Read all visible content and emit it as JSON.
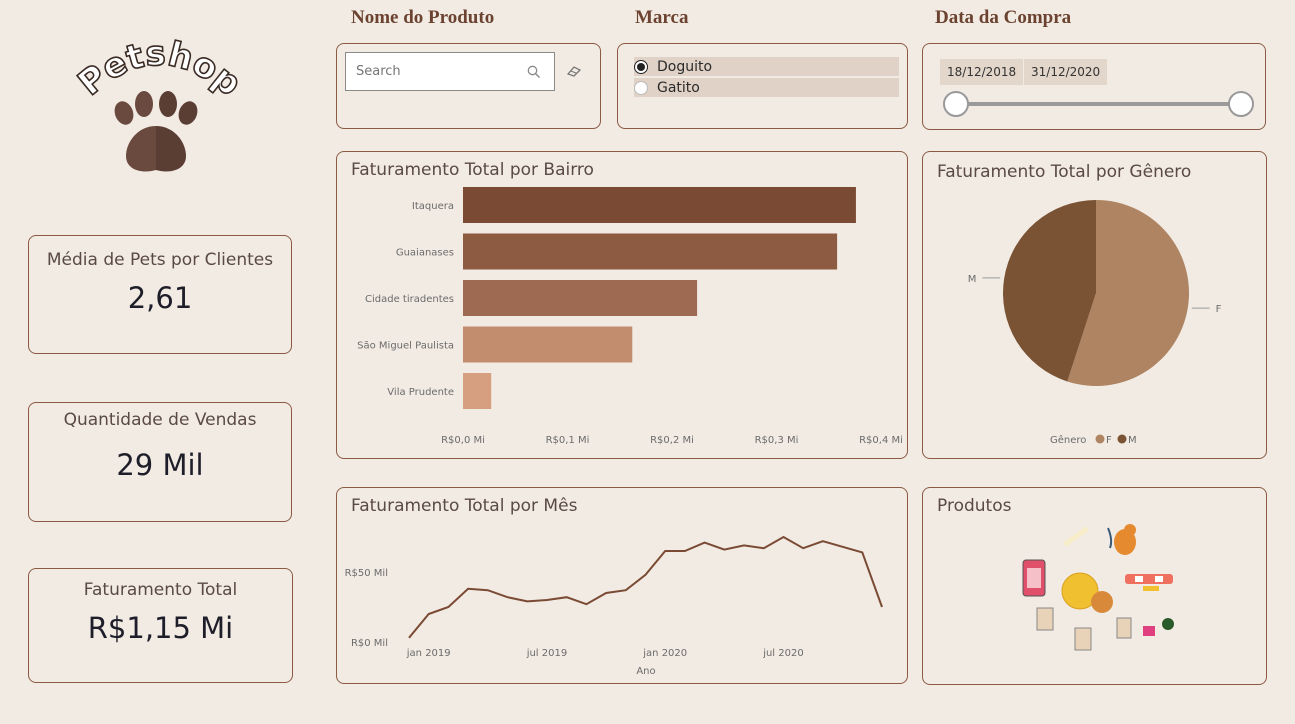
{
  "logo": {
    "text": "Petshop"
  },
  "filters": {
    "produto": {
      "title": "Nome do Produto",
      "placeholder": "Search"
    },
    "marca": {
      "title": "Marca",
      "options": [
        {
          "label": "Doguito",
          "selected": true
        },
        {
          "label": "Gatito",
          "selected": false
        }
      ]
    },
    "data": {
      "title": "Data da Compra",
      "start": "18/12/2018",
      "end": "31/12/2020"
    }
  },
  "kpis": {
    "media_pets": {
      "label": "Média de Pets por Clientes",
      "value": "2,61"
    },
    "vendas": {
      "label": "Quantidade de Vendas",
      "value": "29 Mil"
    },
    "faturamento": {
      "label": "Faturamento Total",
      "value": "R$1,15 Mi"
    }
  },
  "produtos": {
    "title": "Produtos"
  },
  "colors": {
    "bg": "#f2ebe3",
    "border": "#8a5a44",
    "dark_brown": "#7a4a34",
    "tan": "#ae8462"
  },
  "chart_data": [
    {
      "type": "bar",
      "title": "Faturamento Total por Bairro",
      "orientation": "horizontal",
      "categories": [
        "Itaquera",
        "Guaianases",
        "Cidade tiradentes",
        "São Miguel Paulista",
        "Vila Prudente"
      ],
      "values": [
        0.376,
        0.358,
        0.224,
        0.162,
        0.027
      ],
      "colors": [
        "#7a4a34",
        "#8d5a42",
        "#9e6a52",
        "#c28d6e",
        "#d6a080"
      ],
      "xticks": [
        "R$0,0 Mi",
        "R$0,1 Mi",
        "R$0,2 Mi",
        "R$0,3 Mi",
        "R$0,4 Mi"
      ],
      "xlim": [
        0,
        0.4
      ],
      "grid": false
    },
    {
      "type": "pie",
      "title": "Faturamento Total por Gênero",
      "legend_title": "Gênero",
      "labels": [
        "F",
        "M"
      ],
      "values": [
        55,
        45
      ],
      "colors": [
        "#ae8462",
        "#7a5234"
      ],
      "legend_position": "bottom"
    },
    {
      "type": "line",
      "title": "Faturamento Total por Mês",
      "xlabel": "Ano",
      "x": [
        "2018-12",
        "2019-01",
        "2019-02",
        "2019-03",
        "2019-04",
        "2019-05",
        "2019-06",
        "2019-07",
        "2019-08",
        "2019-09",
        "2019-10",
        "2019-11",
        "2019-12",
        "2020-01",
        "2020-02",
        "2020-03",
        "2020-04",
        "2020-05",
        "2020-06",
        "2020-07",
        "2020-08",
        "2020-09",
        "2020-10",
        "2020-11",
        "2020-12"
      ],
      "values": [
        3,
        20,
        25,
        38,
        37,
        32,
        29,
        30,
        32,
        27,
        35,
        37,
        48,
        65,
        65,
        71,
        66,
        69,
        67,
        75,
        67,
        72,
        68,
        64,
        25
      ],
      "xticks": [
        "jan 2019",
        "jul 2019",
        "jan 2020",
        "jul 2020"
      ],
      "yticks": [
        "R$0 Mil",
        "R$50 Mil"
      ],
      "ylim": [
        0,
        100
      ],
      "color": "#7a4a34"
    }
  ]
}
